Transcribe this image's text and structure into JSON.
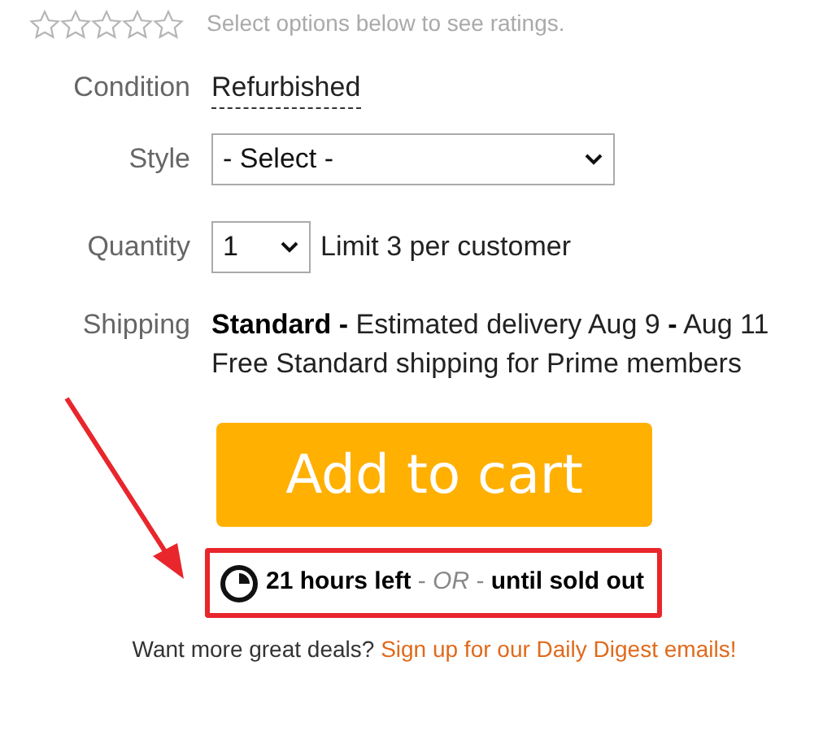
{
  "rating": {
    "stars": 0,
    "note": "Select options below to see ratings."
  },
  "options": [
    {
      "kind": "text",
      "label": "Condition",
      "value": "Refurbished"
    },
    {
      "kind": "select",
      "label": "Style",
      "value": "- Select -"
    },
    {
      "kind": "quantity",
      "label": "Quantity",
      "value": "1",
      "note": "Limit 3 per customer"
    },
    {
      "kind": "shipping",
      "label": "Shipping",
      "lines": [
        "**Standard -** Estimated delivery Aug 9 **-** Aug 11",
        "Free Standard shipping for Prime members"
      ]
    }
  ],
  "add_to_cart": "Add to cart",
  "timer": "**21 hours left** - *OR* - **until sold out**",
  "footer": {
    "text": "Want more great deals?",
    "link": "Sign up for our Daily Digest emails!"
  }
}
